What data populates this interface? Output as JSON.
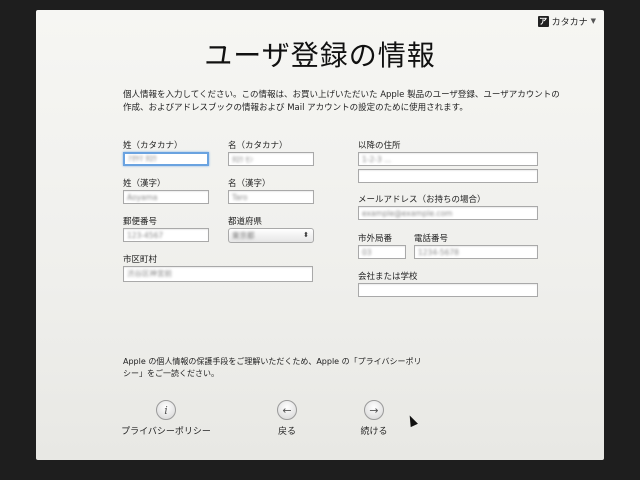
{
  "input_menu": {
    "icon": "katakana-input-icon",
    "label": "カタカナ",
    "arrow": "▼"
  },
  "title": "ユーザ登録の情報",
  "intro": "個人情報を入力してください。この情報は、お買い上げいただいた Apple 製品のユーザ登録、ユーザアカウントの作成、およびアドレスブックの情報および Mail アカウントの設定のために使用されます。",
  "fields": {
    "last_kana": {
      "label": "姓（カタカナ）",
      "value": "ｱｵﾔﾏ ﾀﾛｳ"
    },
    "first_kana": {
      "label": "名（カタカナ）",
      "value": "ﾀﾛｳ ｾﾝ"
    },
    "last_kanji": {
      "label": "姓（漢字）",
      "value": "Aoyama"
    },
    "first_kanji": {
      "label": "名（漢字）",
      "value": "Taro"
    },
    "postal": {
      "label": "郵便番号",
      "value": "123-4567"
    },
    "prefecture": {
      "label": "都道府県",
      "value": "東京都"
    },
    "city": {
      "label": "市区町村",
      "value": "渋谷区神宮前"
    },
    "address": {
      "label": "以降の住所",
      "value": "1-2-3 ...",
      "value2": ""
    },
    "email": {
      "label": "メールアドレス（お持ちの場合）",
      "value": "example@example.com"
    },
    "area_code": {
      "label": "市外局番",
      "value": "03"
    },
    "phone": {
      "label": "電話番号",
      "value": "1234-5678"
    },
    "company": {
      "label": "会社または学校",
      "value": ""
    }
  },
  "privacy_note": "Apple の個人情報の保護手段をご理解いただくため、Apple の「プライバシーポリシー」をご一読ください。",
  "nav": {
    "privacy": {
      "icon": "info-icon",
      "glyph": "i",
      "label": "プライバシーポリシー"
    },
    "back": {
      "icon": "back-arrow-icon",
      "glyph": "←",
      "label": "戻る"
    },
    "continue": {
      "icon": "forward-arrow-icon",
      "glyph": "→",
      "label": "続ける"
    }
  }
}
